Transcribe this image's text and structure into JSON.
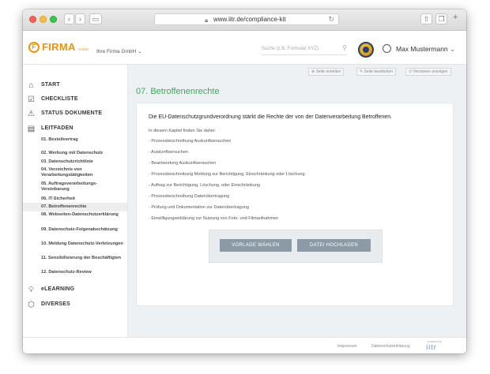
{
  "browser": {
    "url": "www.iitr.de/compliance-kit"
  },
  "header": {
    "logo_mark": "F",
    "logo": "FIRMA",
    "logo_sub": "GmbH",
    "company": "Ihre Firma GmbH",
    "search_placeholder": "Suche (z.B. Formular XYZ)",
    "user": "Max Mustermann"
  },
  "toolbar": {
    "new_page": "Seite erstellen",
    "edit_page": "Seite bearbeiten",
    "versions": "Versionen anzeigen"
  },
  "sidebar": {
    "start": "START",
    "checkliste": "CHECKLISTE",
    "status": "STATUS DOKUMENTE",
    "leitfaden": "LEITFADEN",
    "items": [
      "01. Bestellvertrag",
      "02. Werbung mit Datenschutz",
      "03. Datenschutzrichtlinie",
      "04. Verzeichnis von Verarbeitungstätigkeiten",
      "05. Auftragsverarbeitungs-Vereinbarung",
      "06. IT-Sicherheit",
      "07. Betroffenenrechte",
      "08. Webseiten-Datenschutzerklärung",
      "09. Datenschutz-Folgenabschätzung",
      "10. Meldung Datenschutz-Verletzungen",
      "11. Sensibilisierung der Beschäftigten",
      "12. Datenschutz-Review"
    ],
    "elearning": "eLEARNING",
    "diverses": "DIVERSES"
  },
  "main": {
    "title": "07. Betroffenenrechte",
    "intro": "Die EU-Datenschutzgrundverordnung stärkt die Rechte der von der Datenverarbeitung Betroffenen.",
    "lead": "In diesem Kapitel finden Sie daher:",
    "list": [
      "- Prozessbeschreibung Auskunftsersuchen",
      "- Auskunftsersuchen",
      "- Beantwortung Auskunftsersuchen",
      "- Prozessbeschreibung Meldung zur Berichtigung, Einschränkung oder Löschung",
      "- Auftrag zur Berichtigung, Löschung, oder Einschränkung",
      "- Prozessbeschreibung Datenübertragung",
      "- Prüfung und Dokumentation zur Datenübertragung",
      "- Einwilligungserklärung zur Nutzung von Foto- und Filmaufnahmen"
    ],
    "btn_template": "VORLAGE WÄHLEN",
    "btn_upload": "DATEI HOCHLADEN"
  },
  "footer": {
    "impressum": "Impressum",
    "privacy": "Datenschutzerklärung",
    "powered": "powered by",
    "brand": "iitr"
  }
}
